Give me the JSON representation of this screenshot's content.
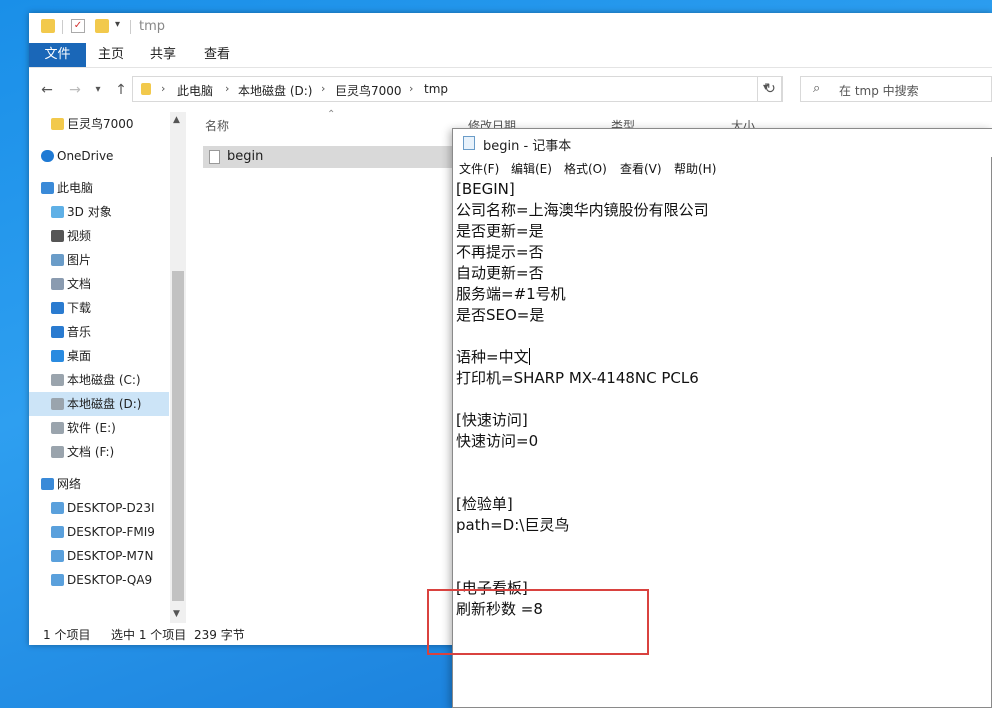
{
  "explorer": {
    "title": "tmp",
    "tabs": [
      "文件",
      "主页",
      "共享",
      "查看"
    ],
    "breadcrumb": [
      "此电脑",
      "本地磁盘 (D:)",
      "巨灵鸟7000",
      "tmp"
    ],
    "search_placeholder": "在 tmp 中搜索",
    "nav_items": [
      {
        "label": "巨灵鸟7000",
        "icon": "folder-icon"
      },
      {
        "label": "OneDrive",
        "icon": "cloud-icon"
      },
      {
        "label": "此电脑",
        "icon": "computer-icon"
      },
      {
        "label": "3D 对象",
        "icon": "cube-icon"
      },
      {
        "label": "视频",
        "icon": "video-icon"
      },
      {
        "label": "图片",
        "icon": "picture-icon"
      },
      {
        "label": "文档",
        "icon": "document-icon"
      },
      {
        "label": "下载",
        "icon": "download-icon"
      },
      {
        "label": "音乐",
        "icon": "music-icon"
      },
      {
        "label": "桌面",
        "icon": "desktop-icon"
      },
      {
        "label": "本地磁盘 (C:)",
        "icon": "drive-icon"
      },
      {
        "label": "本地磁盘 (D:)",
        "icon": "drive-icon",
        "selected": true
      },
      {
        "label": "软件 (E:)",
        "icon": "drive-icon"
      },
      {
        "label": "文档 (F:)",
        "icon": "drive-icon"
      },
      {
        "label": "网络",
        "icon": "network-icon"
      },
      {
        "label": "DESKTOP-D23I",
        "icon": "pc-icon"
      },
      {
        "label": "DESKTOP-FMI9",
        "icon": "pc-icon"
      },
      {
        "label": "DESKTOP-M7N",
        "icon": "pc-icon"
      },
      {
        "label": "DESKTOP-QA9",
        "icon": "pc-icon"
      }
    ],
    "columns": [
      "名称",
      "修改日期",
      "类型",
      "大小"
    ],
    "files": [
      {
        "name": "begin"
      }
    ],
    "status": {
      "count": "1 个项目",
      "selected": "选中 1 个项目",
      "size": "239 字节"
    }
  },
  "notepad": {
    "title": "begin - 记事本",
    "menu": [
      "文件(F)",
      "编辑(E)",
      "格式(O)",
      "查看(V)",
      "帮助(H)"
    ],
    "lines": [
      "[BEGIN]",
      "公司名称=上海澳华内镜股份有限公司",
      "是否更新=是",
      "不再提示=否",
      "自动更新=否",
      "服务端=#1号机",
      "是否SEO=是",
      "",
      "语种=中文",
      "打印机=SHARP MX-4148NC PCL6",
      "",
      "[快速访问]",
      "快速访问=0",
      "",
      "",
      "[检验单]",
      "path=D:\\巨灵鸟",
      "",
      "",
      "[电子看板]",
      "刷新秒数 =8"
    ]
  },
  "colors": {
    "accent": "#1a67b8",
    "highlight_border": "#d9423f",
    "selection": "#cce4f7"
  }
}
